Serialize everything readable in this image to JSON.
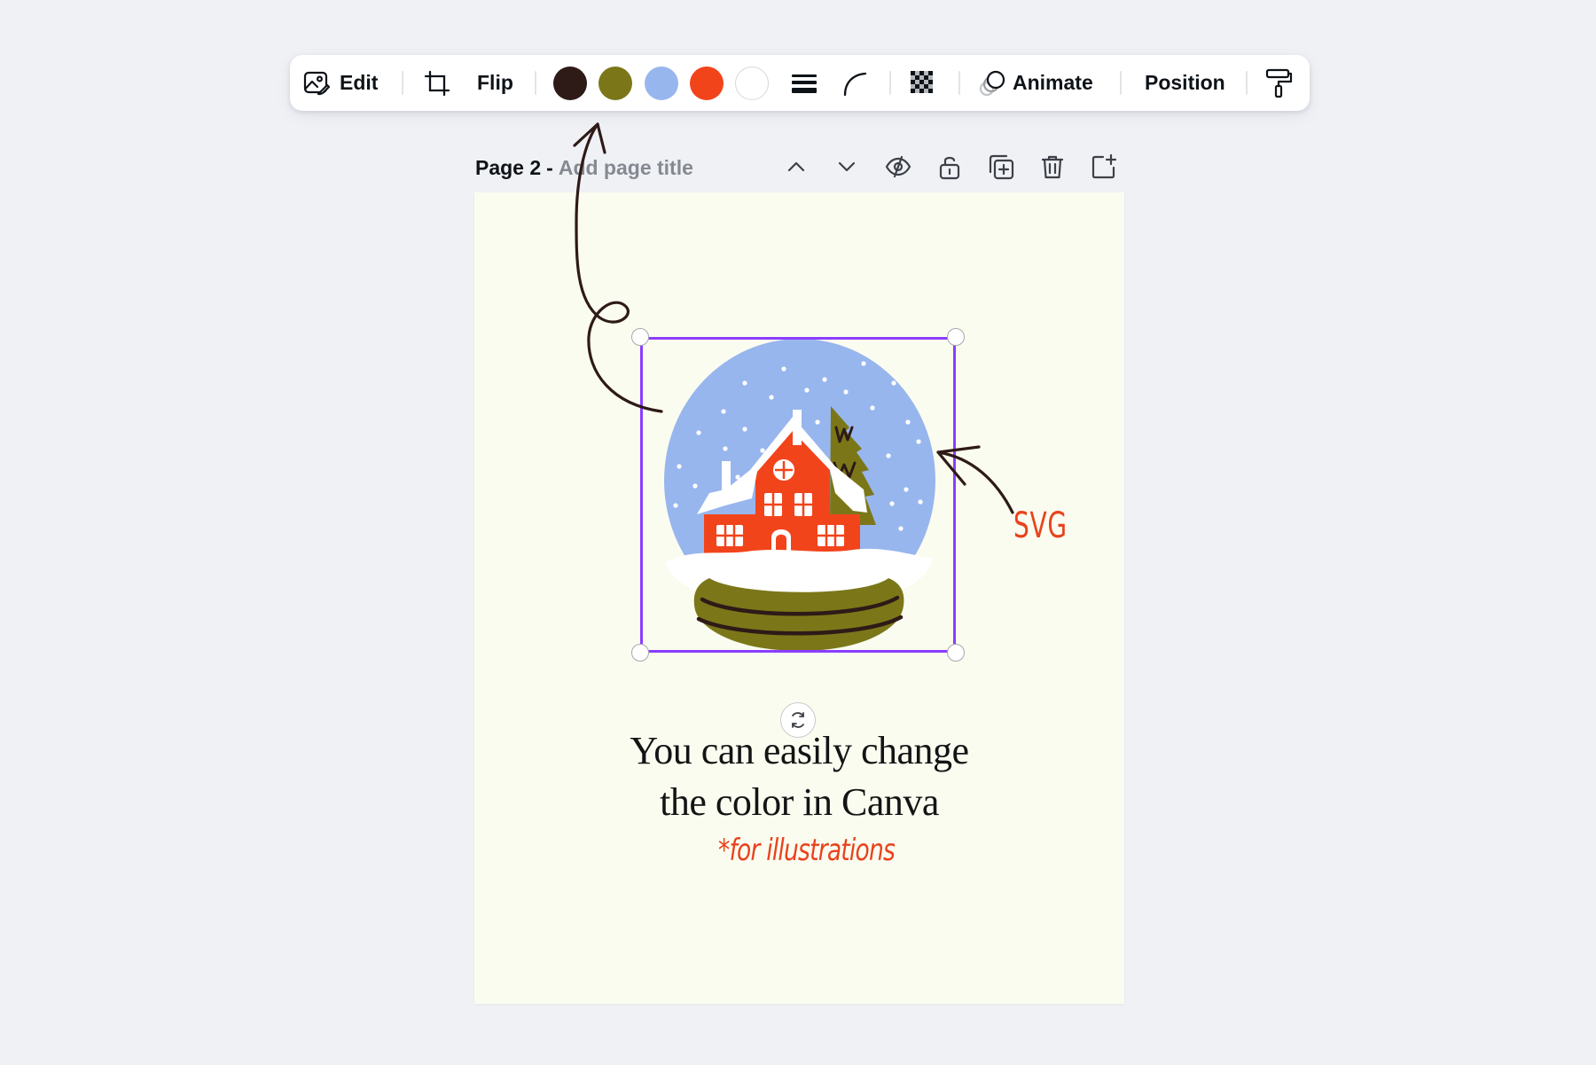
{
  "toolbar": {
    "edit_label": "Edit",
    "flip_label": "Flip",
    "animate_label": "Animate",
    "position_label": "Position",
    "swatches": [
      {
        "name": "swatch-dark-brown",
        "color": "#2e1a17"
      },
      {
        "name": "swatch-olive",
        "color": "#7b7719"
      },
      {
        "name": "swatch-light-blue",
        "color": "#98b6ee"
      },
      {
        "name": "swatch-red-orange",
        "color": "#f2441b"
      },
      {
        "name": "swatch-white",
        "color": "#ffffff"
      }
    ],
    "icons": [
      "edit-image-icon",
      "crop-icon",
      "border-style-icon",
      "corner-rounding-icon",
      "transparency-icon",
      "animate-icon",
      "paint-roller-icon"
    ]
  },
  "page_header": {
    "page_label": "Page 2",
    "separator": "-",
    "title_placeholder": "Add page title",
    "icons": [
      "chevron-up-icon",
      "chevron-down-icon",
      "hide-icon",
      "lock-icon",
      "duplicate-icon",
      "trash-icon",
      "add-page-icon"
    ]
  },
  "canvas": {
    "background": "#fbfcf0",
    "headline_line1": "You can easily change",
    "headline_line2": "the color in Canva",
    "note": "*for illustrations",
    "svg_label": "SVG",
    "selection_color": "#8b3dff",
    "accent_text_color": "#e8431d"
  }
}
